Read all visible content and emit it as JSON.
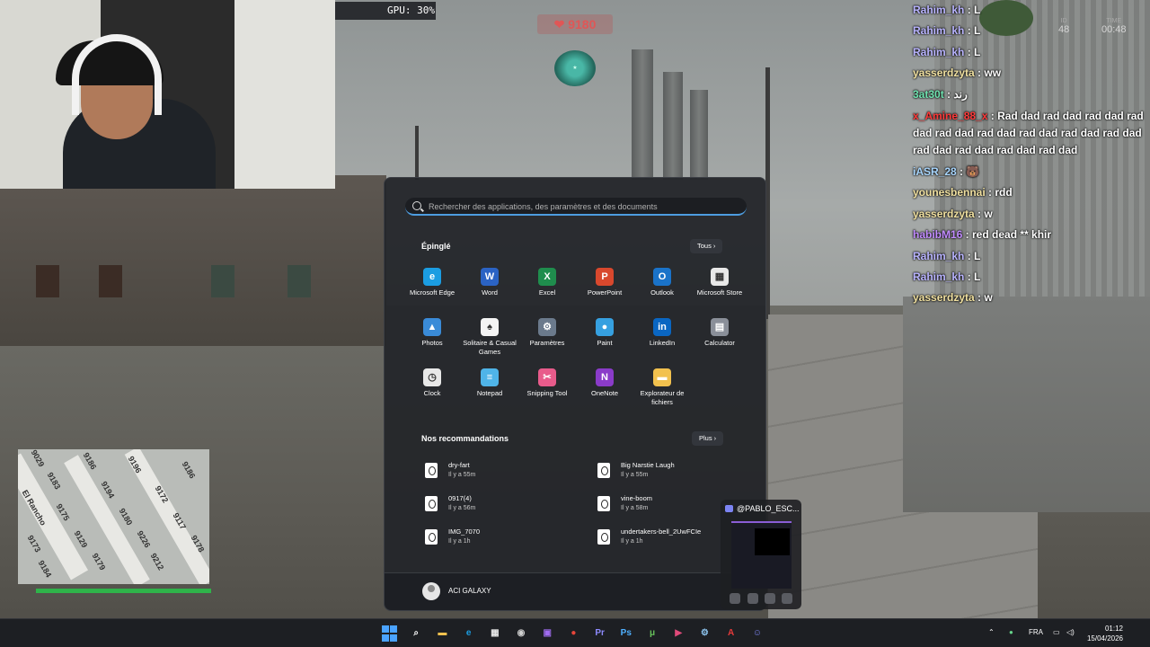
{
  "hud": {
    "gpu": "GPU: 30%",
    "money": "❤ 9180",
    "stat_left_label": "ID",
    "stat_left_value": "48",
    "stat_right_label": "TIME",
    "stat_right_value": "00:48"
  },
  "chat": [
    {
      "user": "Rahim_kh",
      "msg": "L",
      "color": "#b9b4ff"
    },
    {
      "user": "Rahim_kh",
      "msg": "L",
      "color": "#b9b4ff"
    },
    {
      "user": "Rahim_kh",
      "msg": "L",
      "color": "#b9b4ff"
    },
    {
      "user": "yasserdzyta",
      "msg": "ww",
      "color": "#f0e0a0"
    },
    {
      "user": "3at30t",
      "msg": "رند",
      "color": "#6fe3b0"
    },
    {
      "user": "x_Amine_88_x",
      "msg": "Rad dad rad dad rad dad rad dad rad dad rad dad rad dad rad dad rad dad rad dad rad dad rad dad rad dad",
      "color": "#ff3a3a",
      "multi": true
    },
    {
      "user": "iASR_28",
      "msg": "🐻",
      "color": "#a9d7ff"
    },
    {
      "user": "younesbennai",
      "msg": "rdd",
      "color": "#f0e0a0"
    },
    {
      "user": "yasserdzyta",
      "msg": "w",
      "color": "#f0e0a0"
    },
    {
      "user": "habibM16",
      "msg": "red dead ** khir",
      "color": "#c28cff"
    },
    {
      "user": "Rahim_kh",
      "msg": "L",
      "color": "#b9b4ff"
    },
    {
      "user": "Rahim_kh",
      "msg": "L",
      "color": "#b9b4ff"
    },
    {
      "user": "yasserdzyta",
      "msg": "w",
      "color": "#f0e0a0"
    }
  ],
  "minimap": {
    "labels": [
      "9029",
      "9186",
      "9196",
      "9186",
      "9183",
      "9194",
      "9172",
      "9175",
      "9180",
      "9117",
      "9129",
      "9226",
      "9173",
      "9178",
      "9179",
      "9212",
      "9184",
      "El Rancho"
    ]
  },
  "start_menu": {
    "search_placeholder": "Rechercher des applications, des paramètres et des documents",
    "pinned_title": "Épinglé",
    "all_button": "Tous  ›",
    "pinned": [
      {
        "label": "Microsoft Edge",
        "icon": "edge-icon",
        "color": "#1b9de2",
        "glyph": "e"
      },
      {
        "label": "Word",
        "icon": "word-icon",
        "color": "#2b63c4",
        "glyph": "W"
      },
      {
        "label": "Excel",
        "icon": "excel-icon",
        "color": "#1f8d4d",
        "glyph": "X"
      },
      {
        "label": "PowerPoint",
        "icon": "powerpoint-icon",
        "color": "#d8482d",
        "glyph": "P"
      },
      {
        "label": "Outlook",
        "icon": "outlook-icon",
        "color": "#1a73c9",
        "glyph": "O"
      },
      {
        "label": "Microsoft Store",
        "icon": "store-icon",
        "color": "#e8e8e8",
        "glyph": "▦"
      },
      {
        "label": "Photos",
        "icon": "photos-icon",
        "color": "#3a8bd8",
        "glyph": "▲"
      },
      {
        "label": "Solitaire & Casual Games",
        "icon": "solitaire-icon",
        "color": "#f4f4f4",
        "glyph": "♠"
      },
      {
        "label": "Paramètres",
        "icon": "settings-icon",
        "color": "#6b7a8c",
        "glyph": "⚙"
      },
      {
        "label": "Paint",
        "icon": "paint-icon",
        "color": "#36a0e0",
        "glyph": "●"
      },
      {
        "label": "LinkedIn",
        "icon": "linkedin-icon",
        "color": "#0a66c2",
        "glyph": "in"
      },
      {
        "label": "Calculator",
        "icon": "calculator-icon",
        "color": "#8a8f99",
        "glyph": "▤"
      },
      {
        "label": "Clock",
        "icon": "clock-icon",
        "color": "#e8e8e8",
        "glyph": "◷"
      },
      {
        "label": "Notepad",
        "icon": "notepad-icon",
        "color": "#4fb4e8",
        "glyph": "≡"
      },
      {
        "label": "Snipping Tool",
        "icon": "snipping-tool-icon",
        "color": "#e85b8b",
        "glyph": "✂"
      },
      {
        "label": "OneNote",
        "icon": "onenote-icon",
        "color": "#8a3bc9",
        "glyph": "N"
      },
      {
        "label": "Explorateur de fichiers",
        "icon": "folder-icon",
        "color": "#f2c14e",
        "glyph": "▬"
      }
    ],
    "recommended_title": "Nos recommandations",
    "more_button": "Plus  ›",
    "recommended": [
      {
        "name": "dry-fart",
        "time": "Il y a 55m"
      },
      {
        "name": "Big Narstie Laugh",
        "time": "Il y a 55m"
      },
      {
        "name": "0917(4)",
        "time": "Il y a 56m"
      },
      {
        "name": "vine-boom",
        "time": "Il y a 58m"
      },
      {
        "name": "IMG_7070",
        "time": "Il y a 1h"
      },
      {
        "name": "undertakers-bell_2UwFCIe",
        "time": "Il y a 1h"
      }
    ],
    "user": "ACI GALAXY"
  },
  "discord": {
    "name": "@PABLO_ESC..."
  },
  "taskbar": {
    "apps": [
      {
        "name": "start-button",
        "glyph": "",
        "color": "#4aa3ff"
      },
      {
        "name": "taskbar-search-icon",
        "glyph": "⌕",
        "color": "#ffffff"
      },
      {
        "name": "taskbar-file-explorer-icon",
        "glyph": "▬",
        "color": "#f2c14e"
      },
      {
        "name": "taskbar-edge-icon",
        "glyph": "e",
        "color": "#1b9de2"
      },
      {
        "name": "taskbar-store-icon",
        "glyph": "▦",
        "color": "#e8e8e8"
      },
      {
        "name": "taskbar-obs-icon",
        "glyph": "◉",
        "color": "#cfcfcf"
      },
      {
        "name": "taskbar-twitch-icon",
        "glyph": "▣",
        "color": "#a06cf0"
      },
      {
        "name": "taskbar-chrome-icon",
        "glyph": "●",
        "color": "#e6453a"
      },
      {
        "name": "taskbar-premiere-icon",
        "glyph": "Pr",
        "color": "#8e8bff"
      },
      {
        "name": "taskbar-photoshop-icon",
        "glyph": "Ps",
        "color": "#4fb0ff"
      },
      {
        "name": "taskbar-utorrent-icon",
        "glyph": "μ",
        "color": "#66c05a"
      },
      {
        "name": "taskbar-media-player-icon",
        "glyph": "▶",
        "color": "#e04a7a"
      },
      {
        "name": "taskbar-steam-icon",
        "glyph": "⚙",
        "color": "#8ec5f0"
      },
      {
        "name": "taskbar-acrobat-icon",
        "glyph": "A",
        "color": "#e63a3a"
      },
      {
        "name": "taskbar-discord-icon",
        "glyph": "☺",
        "color": "#7c84f2"
      }
    ],
    "language": "FRA",
    "time": "01:12",
    "date": "15/04/2026"
  }
}
